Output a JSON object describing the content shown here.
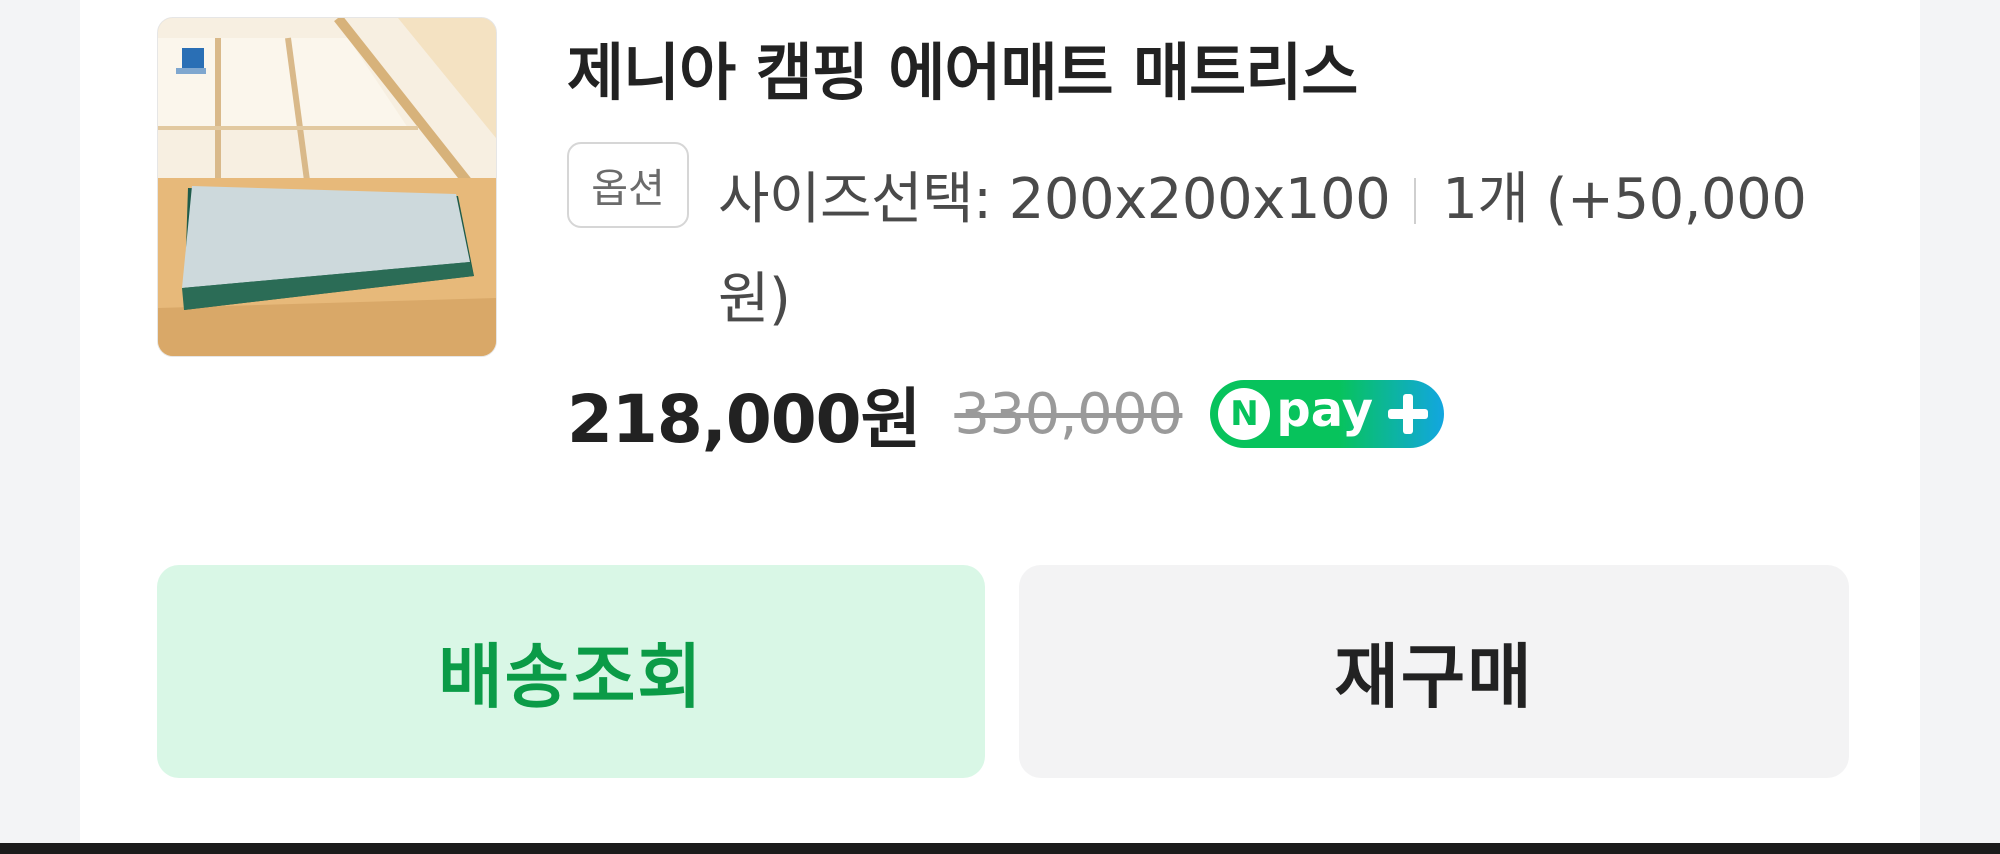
{
  "product": {
    "image_alt": "캠핑 에어매트 상품 이미지",
    "title": "제니아 캠핑 에어매트 매트리스",
    "option_badge": "옵션",
    "option_name": "사이즈선택: 200x200x100",
    "option_qty_price": "1개 (+50,000원)",
    "price": "218,000원",
    "original_price": "330,000",
    "npay_logo": {
      "n": "N",
      "text": "pay",
      "colors": {
        "green": "#07c35c",
        "blue": "#12a6e0"
      }
    }
  },
  "actions": {
    "delivery_label": "배송조회",
    "rebuy_label": "재구매"
  },
  "colors": {
    "delivery_bg": "#d9f7e6",
    "delivery_text": "#0b9b47",
    "rebuy_bg": "#f3f3f4"
  }
}
